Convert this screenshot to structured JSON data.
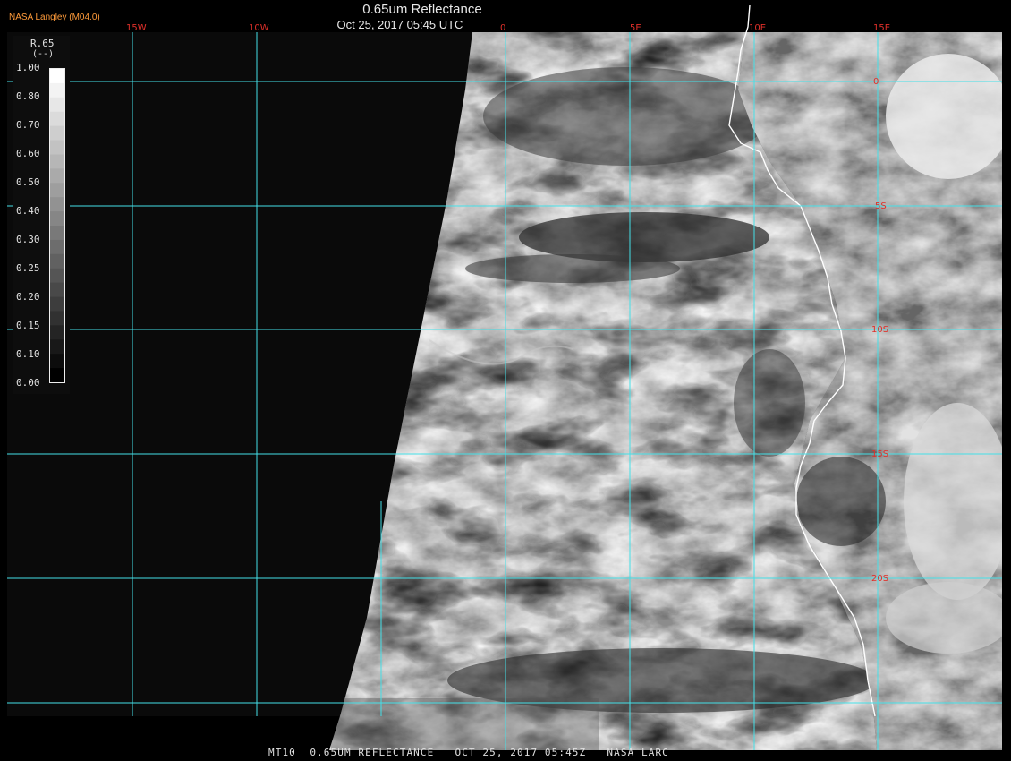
{
  "header": {
    "credit": "NASA Langley (M04.0)",
    "title": "0.65um Reflectance",
    "timestamp": "Oct 25, 2017 05:45 UTC"
  },
  "footer": {
    "caption": "MT10  0.65UM REFLECTANCE   OCT 25, 2017 05:45Z   NASA LARC"
  },
  "legend": {
    "title": "R.65",
    "unit": "(--)",
    "ticks": [
      "1.00",
      "0.80",
      "0.70",
      "0.60",
      "0.50",
      "0.40",
      "0.30",
      "0.25",
      "0.20",
      "0.15",
      "0.10",
      "0.00"
    ],
    "colors": {
      "background": "#000000",
      "space": "#0a0a0a",
      "grid": "#44e0e8",
      "coast": "#ffffff",
      "longitude_label": "#e0302a",
      "latitude_label": "#e0302a"
    }
  },
  "map": {
    "longitude_labels": [
      "15W",
      "10W",
      "0",
      "5E",
      "10E",
      "15E"
    ],
    "latitude_labels": [
      "0",
      "5S",
      "10S",
      "15S",
      "20S"
    ]
  }
}
